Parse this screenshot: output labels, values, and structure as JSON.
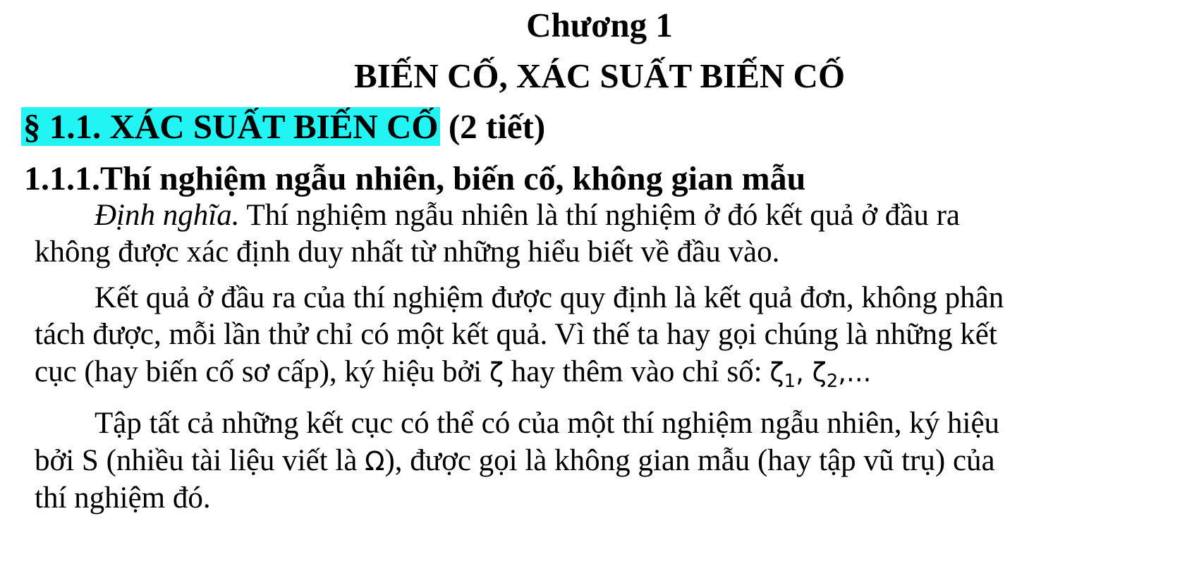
{
  "chapter": {
    "number": "Chương 1",
    "title": "BIẾN CỐ, XÁC SUẤT BIẾN CỐ"
  },
  "section": {
    "heading": "§ 1.1. XÁC SUẤT BIẾN CỐ",
    "duration": "(2 tiết)"
  },
  "subsection": {
    "heading": "1.1.1.Thí nghiệm ngẫu nhiên, biến cố, không gian mẫu"
  },
  "paragraphs": {
    "p1": {
      "label": "Định nghĩa.",
      "line1": "Thí nghiệm ngẫu nhiên là thí nghiệm ở đó kết quả ở đầu ra",
      "line2": "không được xác định duy nhất từ những hiểu biết về đầu vào."
    },
    "p2": {
      "line1": "Kết quả ở đầu ra của thí nghiệm được quy định là kết quả đơn, không phân",
      "line2": "tách được, mỗi lần thử chỉ có một kết quả. Vì thế ta hay gọi chúng là những kết",
      "line3_a": "cục (hay biến cố sơ cấp), ký hiệu bởi",
      "zeta": "ζ",
      "line3_b": "hay thêm vào chỉ số:",
      "sub1": "1",
      "sub2": "2",
      "sep": ",",
      "ellipsis": ",..."
    },
    "p3": {
      "line1": "Tập tất cả những kết cục có thể có của một thí nghiệm ngẫu nhiên, ký hiệu",
      "line2_a": "bởi S (nhiều tài liệu viết là",
      "omega": "Ω",
      "line2_b": "), được gọi là không gian mẫu (hay tập vũ trụ) của",
      "line3": "thí nghiệm đó."
    }
  },
  "colors": {
    "highlight": "#22f4f4",
    "text": "#000000"
  }
}
